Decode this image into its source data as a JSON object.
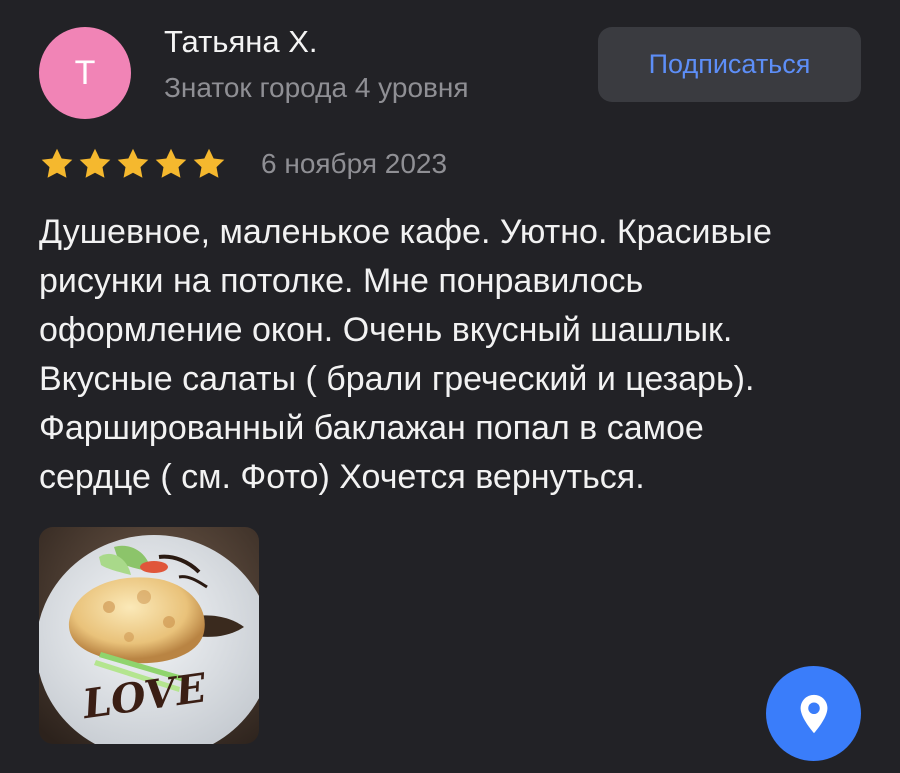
{
  "review": {
    "author": {
      "initial": "Т",
      "name": "Татьяна Х.",
      "level": "Знаток города 4 уровня",
      "avatar_color": "#f184b6"
    },
    "subscribe_label": "Подписаться",
    "rating": 5,
    "rating_max": 5,
    "date": "6 ноября 2023",
    "text": "Душевное, маленькое кафе. Уютно. Красивые\nрисунки на потолке. Мне понравилось\nоформление окон. Очень вкусный шашлык.\nВкусные салаты ( брали греческий и цезарь).\nФаршированный баклажан попал в самое\nсердце ( см. Фото) Хочется вернуться.",
    "photo": {
      "icon": "food-photo",
      "plate_text": "LOVE"
    }
  },
  "fab": {
    "icon": "map-pin-icon"
  },
  "colors": {
    "background": "#222226",
    "accent": "#5d8ef7",
    "star": "#f5b82e",
    "fab": "#3a7dfa"
  }
}
